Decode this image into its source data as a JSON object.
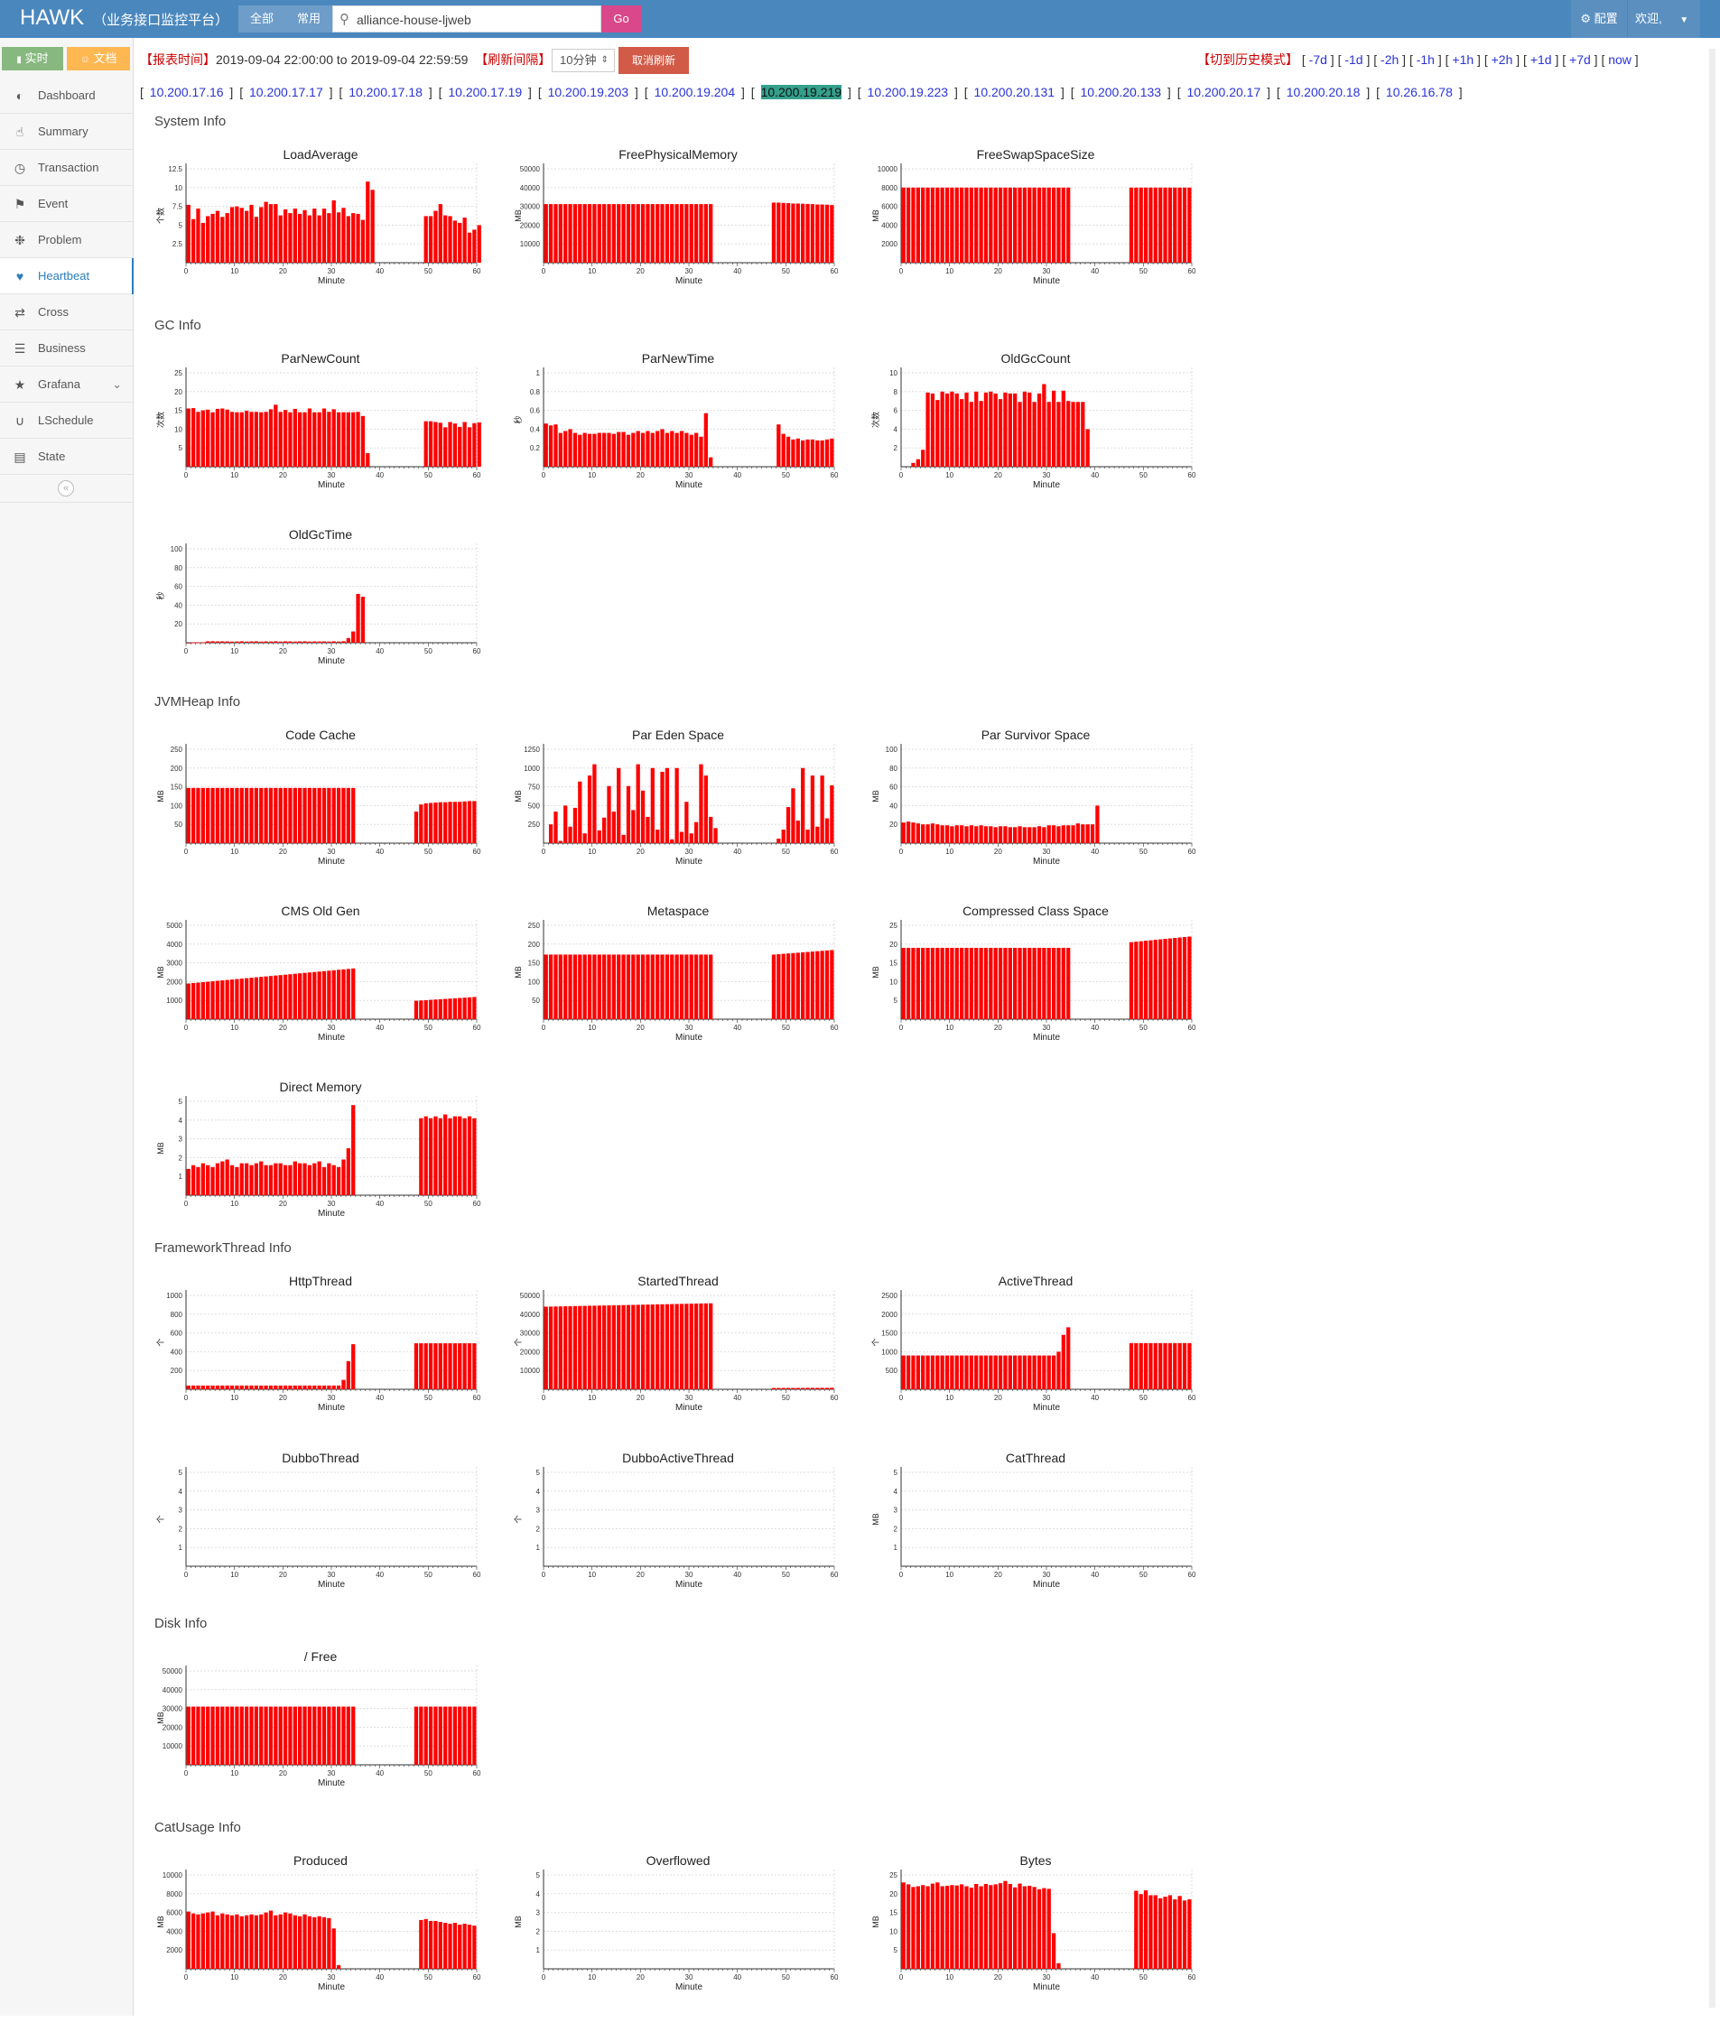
{
  "header": {
    "brand": "HAWK",
    "brand_sub": "（业务接口监控平台）",
    "filter_all": "全部",
    "filter_common": "常用",
    "search_value": "alliance-house-ljweb",
    "go_label": "Go",
    "config_label": "配置",
    "welcome_label": "欢迎,"
  },
  "sidebar": {
    "realtime_label": "实时",
    "docs_label": "文档",
    "items": [
      {
        "label": "Dashboard",
        "icon": "dashboard-icon"
      },
      {
        "label": "Summary",
        "icon": "thumbs-up-icon"
      },
      {
        "label": "Transaction",
        "icon": "clock-icon"
      },
      {
        "label": "Event",
        "icon": "flag-icon"
      },
      {
        "label": "Problem",
        "icon": "bug-icon"
      },
      {
        "label": "Heartbeat",
        "icon": "heart-icon",
        "active": true
      },
      {
        "label": "Cross",
        "icon": "shuffle-icon"
      },
      {
        "label": "Business",
        "icon": "list-icon"
      },
      {
        "label": "Grafana",
        "icon": "star-icon",
        "has_submenu": true
      },
      {
        "label": "LSchedule",
        "icon": "magnet-icon"
      },
      {
        "label": "State",
        "icon": "bar-chart-icon"
      }
    ]
  },
  "report": {
    "label": "【报表时间】",
    "range": "2019-09-04 22:00:00 to 2019-09-04 22:59:59",
    "interval_label": "【刷新间隔】",
    "interval_value": "10分钟",
    "cancel_label": "取消刷新",
    "history_label": "【切到历史模式】",
    "history_links": [
      "-7d",
      "-1d",
      "-2h",
      "-1h",
      "+1h",
      "+2h",
      "+1d",
      "+7d",
      "now"
    ]
  },
  "ips": [
    "10.200.17.16",
    "10.200.17.17",
    "10.200.17.18",
    "10.200.17.19",
    "10.200.19.203",
    "10.200.19.204",
    "10.200.19.219",
    "10.200.19.223",
    "10.200.20.131",
    "10.200.20.133",
    "10.200.20.17",
    "10.200.20.18",
    "10.26.16.78"
  ],
  "selected_ip": "10.200.19.219",
  "colors": {
    "bar": "#ff0000",
    "header": "#4a87bd",
    "active": "#2b7dbc"
  },
  "sections": [
    "System Info",
    "GC Info",
    "JVMHeap Info",
    "FrameworkThread Info",
    "Disk Info",
    "CatUsage Info"
  ],
  "chart_data": [
    {
      "id": "LoadAverage",
      "type": "bar",
      "title": "LoadAverage",
      "xlabel": "Minute",
      "ylabel": "个数",
      "yticks": [
        "2.5",
        "5",
        "7.5",
        "10",
        "12.5"
      ],
      "ylim": [
        0,
        12.5
      ],
      "x": [
        0,
        59
      ],
      "values": [
        7.7,
        5.8,
        7.2,
        5.3,
        6.2,
        6.5,
        6.9,
        6.1,
        6.6,
        7.4,
        7.5,
        7.3,
        6.9,
        7.7,
        6.1,
        7.4,
        8.1,
        7.8,
        7.8,
        6.3,
        7.1,
        6.6,
        7.2,
        6.5,
        7.0,
        6.3,
        7.2,
        6.3,
        7.2,
        6.6,
        8.3,
        6.7,
        7.3,
        6.2,
        6.6,
        6.5,
        5.7,
        10.8,
        9.7,
        null,
        null,
        null,
        null,
        null,
        null,
        null,
        null,
        null,
        null,
        6.2,
        6.2,
        6.9,
        7.8,
        6.3,
        6.2,
        5.6,
        5.3,
        6.0,
        4.0,
        4.4,
        5.0
      ]
    },
    {
      "id": "FreePhysicalMemory",
      "type": "bar",
      "title": "FreePhysicalMemory",
      "xlabel": "Minute",
      "ylabel": "MB",
      "yticks": [
        "10000",
        "20000",
        "30000",
        "40000",
        "50000"
      ],
      "ylim": [
        0,
        50000
      ],
      "values": "31200x35,null x12,32000,32000,31800,31700,31500,31500,31400,31300,31200,31000,31000,30900,30700"
    },
    {
      "id": "FreeSwapSpaceSize",
      "type": "bar",
      "title": "FreeSwapSpaceSize",
      "xlabel": "Minute",
      "ylabel": "MB",
      "yticks": [
        "2000",
        "4000",
        "6000",
        "8000",
        "10000"
      ],
      "ylim": [
        0,
        10000
      ],
      "values": "8000x35,null x12,8000x13"
    },
    {
      "id": "ParNewCount",
      "type": "bar",
      "title": "ParNewCount",
      "xlabel": "Minute",
      "ylabel": "次数",
      "yticks": [
        "5",
        "10",
        "15",
        "20",
        "25"
      ],
      "ylim": [
        0,
        25
      ],
      "values": [
        15.5,
        15.6,
        14.6,
        15.0,
        15.2,
        14.5,
        15.4,
        15.5,
        15.2,
        14.6,
        14.5,
        14.5,
        14.9,
        14.6,
        14.6,
        14.5,
        14.6,
        15.3,
        16.5,
        14.6,
        15.1,
        14.5,
        15.4,
        14.5,
        14.5,
        15.5,
        14.5,
        14.5,
        15.5,
        14.6,
        15.3,
        14.5,
        14.5,
        14.5,
        14.5,
        14.6,
        13.5,
        3.6,
        null,
        null,
        null,
        null,
        null,
        null,
        null,
        null,
        null,
        null,
        null,
        12.1,
        12.1,
        11.9,
        11.7,
        10.5,
        11.9,
        11.5,
        10.6,
        11.9,
        10.5,
        11.6,
        11.8
      ]
    },
    {
      "id": "ParNewTime",
      "type": "bar",
      "title": "ParNewTime",
      "xlabel": "Minute",
      "ylabel": "秒",
      "yticks": [
        "0.2",
        "0.4",
        "0.6",
        "0.8",
        "1"
      ],
      "ylim": [
        0,
        1
      ],
      "values": [
        0.46,
        0.44,
        0.45,
        0.36,
        0.38,
        0.4,
        0.36,
        0.34,
        0.36,
        0.35,
        0.35,
        0.36,
        0.36,
        0.36,
        0.35,
        0.37,
        0.37,
        0.34,
        0.36,
        0.38,
        0.36,
        0.38,
        0.36,
        0.38,
        0.4,
        0.36,
        0.38,
        0.36,
        0.38,
        0.36,
        0.34,
        0.36,
        0.32,
        0.57,
        0.1,
        null,
        null,
        null,
        null,
        null,
        null,
        null,
        null,
        null,
        null,
        null,
        null,
        null,
        0.45,
        0.35,
        0.32,
        0.29,
        0.3,
        0.28,
        0.29,
        0.29,
        0.28,
        0.28,
        0.29,
        0.3
      ]
    },
    {
      "id": "OldGcCount",
      "type": "bar",
      "title": "OldGcCount",
      "xlabel": "Minute",
      "ylabel": "次数",
      "yticks": [
        "2",
        "4",
        "6",
        "8",
        "10"
      ],
      "ylim": [
        0,
        10
      ],
      "values": [
        null,
        null,
        0.4,
        0.8,
        1.8,
        7.9,
        7.8,
        7.1,
        8.0,
        7.8,
        8.0,
        7.8,
        7.2,
        7.9,
        6.9,
        8.0,
        7.0,
        7.9,
        8.0,
        7.8,
        7.2,
        7.9,
        7.8,
        7.8,
        6.9,
        8.0,
        7.9,
        6.9,
        7.8,
        8.8,
        6.9,
        8.1,
        6.9,
        8.1,
        7.0,
        6.9,
        6.9,
        6.9,
        4.0,
        null,
        null,
        null,
        null,
        null,
        null,
        null,
        null,
        null,
        null,
        null,
        null,
        null,
        null,
        null,
        null,
        null,
        null,
        null,
        null,
        null
      ]
    },
    {
      "id": "OldGcTime",
      "type": "bar",
      "title": "OldGcTime",
      "xlabel": "Minute",
      "ylabel": "秒",
      "yticks": [
        "20",
        "40",
        "60",
        "80",
        "100"
      ],
      "ylim": [
        0,
        100
      ],
      "values": [
        0,
        0.3,
        0.4,
        0.5,
        1.5,
        1.6,
        1.4,
        1.5,
        1.4,
        1.2,
        1.3,
        1.5,
        1.2,
        1.4,
        1.5,
        1.2,
        1.4,
        1.3,
        1.5,
        1.2,
        1.5,
        1.4,
        1.2,
        1.4,
        1.5,
        1.2,
        1.4,
        1.3,
        1.4,
        1.2,
        1.5,
        1.3,
        1.6,
        5,
        12,
        52,
        49,
        null,
        null,
        null,
        null,
        null,
        null,
        null,
        null,
        null,
        null,
        null,
        null,
        null,
        null,
        null,
        null,
        null,
        null,
        null,
        null,
        null,
        null,
        null
      ]
    },
    {
      "id": "CodeCache",
      "type": "bar",
      "title": "Code Cache",
      "xlabel": "Minute",
      "ylabel": "MB",
      "yticks": [
        "50",
        "100",
        "150",
        "200",
        "250"
      ],
      "ylim": [
        0,
        250
      ],
      "values": "147x35,null x12,84,103,106,107,108,109,109,110,110,110,111,112,112"
    },
    {
      "id": "ParEdenSpace",
      "type": "bar",
      "title": "Par Eden Space",
      "xlabel": "Minute",
      "ylabel": "MB",
      "yticks": [
        "250",
        "500",
        "750",
        "1000",
        "1250"
      ],
      "ylim": [
        0,
        1250
      ],
      "values": [
        null,
        250,
        420,
        30,
        500,
        220,
        470,
        820,
        130,
        900,
        1050,
        170,
        340,
        760,
        420,
        1000,
        110,
        760,
        440,
        1050,
        700,
        350,
        1000,
        180,
        950,
        1000,
        50,
        1000,
        150,
        550,
        130,
        280,
        1050,
        900,
        350,
        200,
        null,
        null,
        null,
        null,
        null,
        null,
        null,
        null,
        null,
        null,
        null,
        null,
        60,
        180,
        480,
        730,
        300,
        1000,
        180,
        900,
        220,
        900,
        330,
        770
      ]
    },
    {
      "id": "ParSurvivorSpace",
      "type": "bar",
      "title": "Par Survivor Space",
      "xlabel": "Minute",
      "ylabel": "MB",
      "yticks": [
        "20",
        "40",
        "60",
        "80",
        "100"
      ],
      "ylim": [
        0,
        100
      ],
      "values": [
        22,
        23,
        22,
        21,
        20,
        20,
        21,
        20,
        19,
        19,
        18,
        19,
        19,
        18,
        19,
        18,
        19,
        18,
        18,
        17,
        18,
        18,
        17,
        17,
        18,
        17,
        17,
        17,
        18,
        17,
        19,
        19,
        18,
        19,
        19,
        19,
        21,
        20,
        20,
        20,
        40,
        null,
        null,
        null,
        null,
        null,
        null,
        null,
        null,
        null,
        null,
        null,
        null,
        null,
        null,
        null,
        null,
        null,
        null,
        null
      ]
    },
    {
      "id": "CMSOldGen",
      "type": "bar",
      "title": "CMS Old Gen",
      "xlabel": "Minute",
      "ylabel": "MB",
      "yticks": [
        "1000",
        "2000",
        "3000",
        "4000",
        "5000"
      ],
      "ylim": [
        0,
        5000
      ],
      "values": "ramp:1900-2700x35,null x12,ramp:980-1180x13"
    },
    {
      "id": "Metaspace",
      "type": "bar",
      "title": "Metaspace",
      "xlabel": "Minute",
      "ylabel": "MB",
      "yticks": [
        "50",
        "100",
        "150",
        "200",
        "250"
      ],
      "ylim": [
        0,
        250
      ],
      "values": "172x35,null x12,ramp:172-184x13"
    },
    {
      "id": "CompressedClassSpace",
      "type": "bar",
      "title": "Compressed Class Space",
      "xlabel": "Minute",
      "ylabel": "MB",
      "yticks": [
        "5",
        "10",
        "15",
        "20",
        "25"
      ],
      "ylim": [
        0,
        25
      ],
      "values": "19x35,null x12,ramp:20.5-22x13"
    },
    {
      "id": "DirectMemory",
      "type": "bar",
      "title": "Direct Memory",
      "xlabel": "Minute",
      "ylabel": "MB",
      "yticks": [
        "1",
        "2",
        "3",
        "4",
        "5"
      ],
      "ylim": [
        0,
        5
      ],
      "values": [
        1.4,
        1.6,
        1.5,
        1.7,
        1.6,
        1.5,
        1.7,
        1.8,
        1.9,
        1.6,
        1.5,
        1.7,
        1.7,
        1.6,
        1.7,
        1.8,
        1.6,
        1.6,
        1.7,
        1.7,
        1.6,
        1.6,
        1.8,
        1.7,
        1.7,
        1.6,
        1.7,
        1.8,
        1.5,
        1.7,
        1.6,
        1.5,
        1.9,
        2.5,
        4.8,
        null,
        null,
        null,
        null,
        null,
        null,
        null,
        null,
        null,
        null,
        null,
        null,
        null,
        4.1,
        4.2,
        4.1,
        4.2,
        4.1,
        4.3,
        4.1,
        4.2,
        4.2,
        4.1,
        4.2,
        4.1
      ]
    },
    {
      "id": "HttpThread",
      "type": "bar",
      "title": "HttpThread",
      "xlabel": "Minute",
      "ylabel": "个",
      "yticks": [
        "200",
        "400",
        "600",
        "800",
        "1000"
      ],
      "ylim": [
        0,
        1000
      ],
      "values": "40x32,100,300,480,null x12,490x13"
    },
    {
      "id": "StartedThread",
      "type": "bar",
      "title": "StartedThread",
      "xlabel": "Minute",
      "ylabel": "个",
      "yticks": [
        "10000",
        "20000",
        "30000",
        "40000",
        "50000"
      ],
      "ylim": [
        0,
        50000
      ],
      "values": "ramp:44000-45800x35,null x12,ramp:700-800x13"
    },
    {
      "id": "ActiveThread",
      "type": "bar",
      "title": "ActiveThread",
      "xlabel": "Minute",
      "ylabel": "个",
      "yticks": [
        "500",
        "1000",
        "1500",
        "2000",
        "2500"
      ],
      "ylim": [
        0,
        2500
      ],
      "values": "900x32,1000,1450,1650,null x12,1230x13"
    },
    {
      "id": "DubboThread",
      "type": "bar",
      "title": "DubboThread",
      "xlabel": "Minute",
      "ylabel": "个",
      "yticks": [
        "1",
        "2",
        "3",
        "4",
        "5"
      ],
      "ylim": [
        0,
        5
      ],
      "values": "null x60"
    },
    {
      "id": "DubboActiveThread",
      "type": "bar",
      "title": "DubboActiveThread",
      "xlabel": "Minute",
      "ylabel": "个",
      "yticks": [
        "1",
        "2",
        "3",
        "4",
        "5"
      ],
      "ylim": [
        0,
        5
      ],
      "values": "null x60"
    },
    {
      "id": "CatThread",
      "type": "bar",
      "title": "CatThread",
      "xlabel": "Minute",
      "ylabel": "MB",
      "yticks": [
        "1",
        "2",
        "3",
        "4",
        "5"
      ],
      "ylim": [
        0,
        5
      ],
      "values": "null x60"
    },
    {
      "id": "RootFree",
      "type": "bar",
      "title": "/ Free",
      "xlabel": "Minute",
      "ylabel": "MB",
      "yticks": [
        "10000",
        "20000",
        "30000",
        "40000",
        "50000"
      ],
      "ylim": [
        0,
        50000
      ],
      "values": "31000x35,null x12,31000x13"
    },
    {
      "id": "Produced",
      "type": "bar",
      "title": "Produced",
      "xlabel": "Minute",
      "ylabel": "MB",
      "yticks": [
        "2000",
        "4000",
        "6000",
        "8000",
        "10000"
      ],
      "ylim": [
        0,
        10000
      ],
      "values": [
        6100,
        5900,
        5800,
        5900,
        6000,
        6100,
        5700,
        5900,
        5800,
        5700,
        5800,
        5600,
        5700,
        5800,
        5700,
        5800,
        6000,
        6200,
        5700,
        5800,
        6000,
        5900,
        5700,
        5600,
        5800,
        5600,
        5500,
        5600,
        5500,
        5400,
        4300,
        400,
        null,
        null,
        null,
        null,
        null,
        null,
        null,
        null,
        null,
        null,
        null,
        null,
        null,
        null,
        null,
        null,
        5200,
        5300,
        5100,
        5100,
        5000,
        4900,
        4800,
        4900,
        4700,
        4800,
        4700,
        4600
      ]
    },
    {
      "id": "Overflowed",
      "type": "bar",
      "title": "Overflowed",
      "xlabel": "Minute",
      "ylabel": "MB",
      "yticks": [
        "1",
        "2",
        "3",
        "4",
        "5"
      ],
      "ylim": [
        0,
        5
      ],
      "values": "null x60"
    },
    {
      "id": "Bytes",
      "type": "bar",
      "title": "Bytes",
      "xlabel": "Minute",
      "ylabel": "MB",
      "yticks": [
        "5",
        "10",
        "15",
        "20",
        "25"
      ],
      "ylim": [
        0,
        25
      ],
      "values": [
        23,
        22.5,
        21.8,
        22,
        22.3,
        22,
        22.7,
        23,
        22,
        22.1,
        22.3,
        22.2,
        22.5,
        22,
        21.6,
        22.6,
        22,
        22.6,
        22.3,
        22.5,
        22.8,
        23.4,
        22.6,
        21.7,
        22.7,
        22,
        22.1,
        21.8,
        21.2,
        21.5,
        21.3,
        9.5,
        1.5,
        null,
        null,
        null,
        null,
        null,
        null,
        null,
        null,
        null,
        null,
        null,
        null,
        null,
        null,
        null,
        20.8,
        19.9,
        20.9,
        19.6,
        19.6,
        18.8,
        19.2,
        19.6,
        18.5,
        19.4,
        18.2,
        18.5
      ]
    }
  ]
}
